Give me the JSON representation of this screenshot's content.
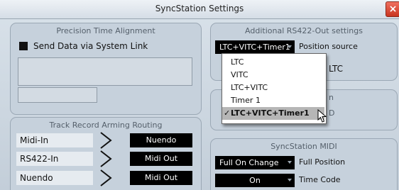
{
  "window": {
    "title": "SyncStation Settings"
  },
  "pta": {
    "title": "Precision Time Alignment",
    "send_label": "Send Data via System Link"
  },
  "rs422": {
    "title": "Additional RS422-Out settings",
    "position_source_value": "LTC+VITC+Timer1",
    "position_source_label": "Position source",
    "partial_value": "LTC",
    "partial_label_a": "n",
    "partial_label_b": "D"
  },
  "menu": {
    "items": [
      "LTC",
      "VITC",
      "LTC+VITC",
      "Timer 1",
      "LTC+VITC+Timer1"
    ],
    "checkmark": "✓"
  },
  "track": {
    "title": "Track Record Arming Routing",
    "rows": [
      {
        "source": "Midi-In",
        "dest": "Nuendo"
      },
      {
        "source": "RS422-In",
        "dest": "Midi Out"
      },
      {
        "source": "Nuendo",
        "dest": "Midi Out"
      }
    ]
  },
  "midi": {
    "title": "SyncStation MIDI",
    "full_value": "Full On Change",
    "full_label": "Full Position",
    "tc_value": "On",
    "tc_label": "Time Code"
  }
}
